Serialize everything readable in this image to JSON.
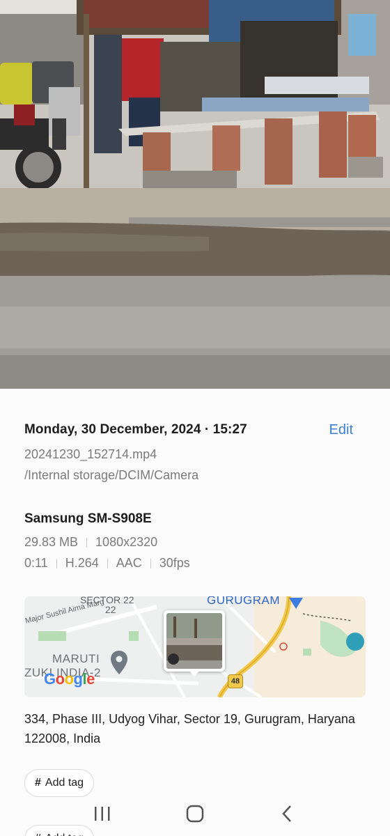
{
  "details": {
    "date_time": "Monday, 30 December, 2024 · 15:27",
    "edit_label": "Edit",
    "filename": "20241230_152714.mp4",
    "path": "/Internal storage/DCIM/Camera",
    "device": "Samsung SM-S908E",
    "size": "29.83 MB",
    "resolution": "1080x2320",
    "duration": "0:11",
    "video_codec": "H.264",
    "audio_codec": "AAC",
    "frame_rate": "30fps",
    "address": "334, Phase III, Udyog Vihar, Sector 19, Gurugram, Haryana 122008, India",
    "add_tag_label": "Add tag"
  },
  "map": {
    "labels": {
      "sector": "SECTOR 22",
      "sector_num": "22",
      "road": "Major Sushil Aima Marg",
      "gurugram": "GURUGRAM",
      "maruti": "MARUTI",
      "suzuki": "ZUKI INDIA-2",
      "highway": "48"
    },
    "logo": [
      "G",
      "o",
      "o",
      "g",
      "l",
      "e"
    ]
  },
  "colors": {
    "accent": "#3c7fd6",
    "map_road": "#f2c84b",
    "map_water": "#2f9fb8"
  },
  "icons": {
    "recent_apps": "recent-apps-icon",
    "home": "home-icon",
    "back": "back-icon",
    "tag": "hash-icon",
    "location_pin": "location-pin-icon"
  }
}
